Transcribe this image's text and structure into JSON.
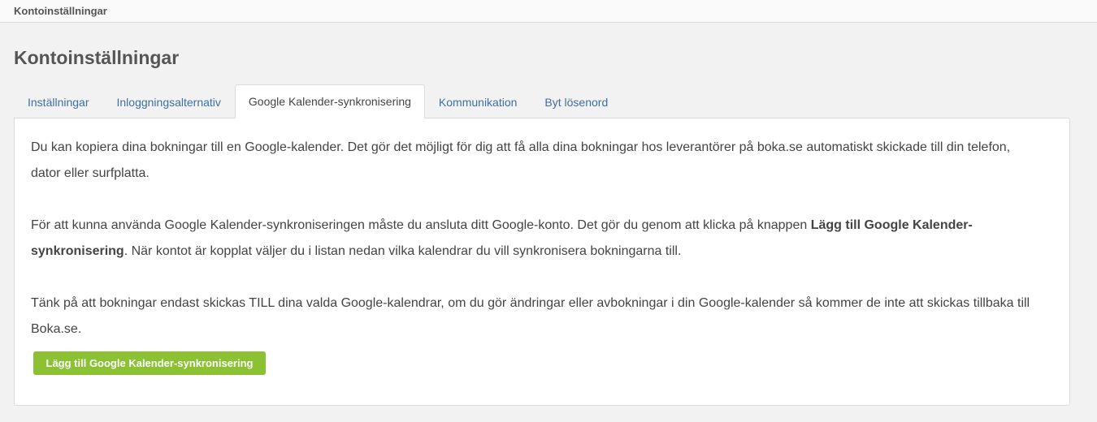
{
  "breadcrumb": {
    "current": "Kontoinställningar"
  },
  "page": {
    "title": "Kontoinställningar"
  },
  "tabs": [
    {
      "label": "Inställningar"
    },
    {
      "label": "Inloggningsalternativ"
    },
    {
      "label": "Google Kalender-synkronisering",
      "active": true
    },
    {
      "label": "Kommunikation"
    },
    {
      "label": "Byt lösenord"
    }
  ],
  "content": {
    "p1": "Du kan kopiera dina bokningar till en Google-kalender. Det gör det möjligt för dig att få alla dina bokningar hos leverantörer på boka.se automatiskt skickade till din telefon, dator eller surfplatta.",
    "p2_before": "För att kunna använda Google Kalender-synkroniseringen måste du ansluta ditt Google-konto. Det gör du genom att klicka på knappen ",
    "p2_bold": "Lägg till Google Kalender-synkronisering",
    "p2_after": ". När kontot är kopplat väljer du i listan nedan vilka kalendrar du vill synkronisera bokningarna till.",
    "p3": "Tänk på att bokningar endast skickas TILL dina valda Google-kalendrar, om du gör ändringar eller avbokningar i din Google-kalender så kommer de inte att skickas tillbaka till Boka.se."
  },
  "actions": {
    "add_sync_label": "Lägg till Google Kalender-synkronisering"
  },
  "colors": {
    "accent_button": "#8bc133",
    "link": "#3e6ea5",
    "background": "#f2f2f2"
  }
}
